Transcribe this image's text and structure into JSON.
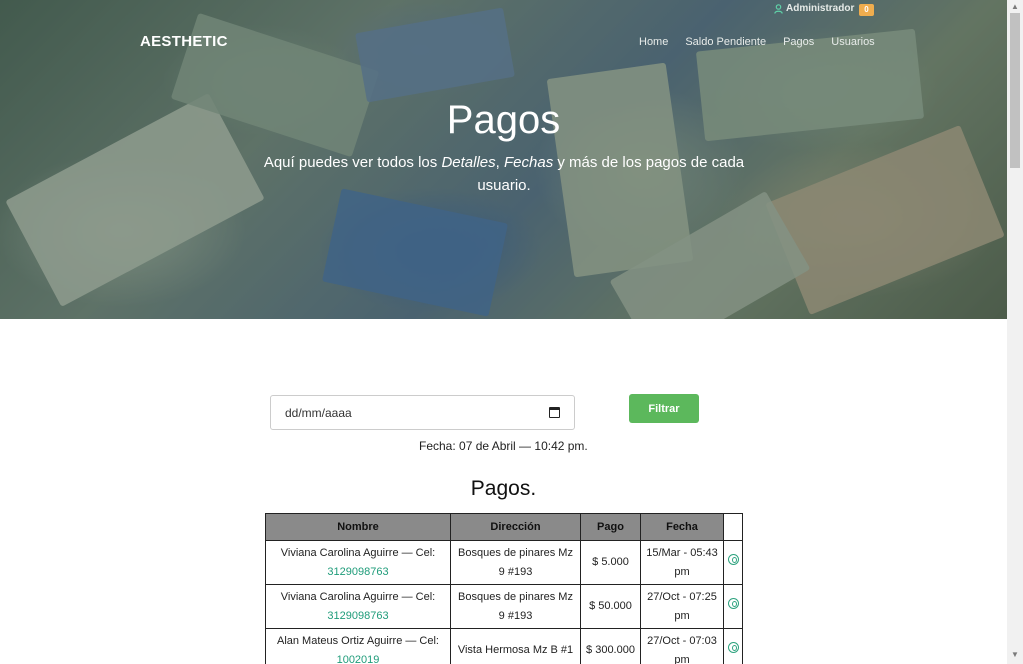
{
  "nav": {
    "brand": "AESTHETIC",
    "items": [
      "Home",
      "Saldo Pendiente",
      "Pagos",
      "Usuarios"
    ],
    "admin_label": "Administrador",
    "notification_count": "0"
  },
  "hero": {
    "title": "Pagos",
    "subtitle_parts": [
      "Aquí puedes ver todos los ",
      "Detalles",
      ", ",
      "Fechas",
      " y más de los pagos de cada usuario."
    ]
  },
  "filter": {
    "date_placeholder": "dd/mm/aaaa",
    "button_label": "Filtrar",
    "fecha_text": "Fecha: 07 de Abril — 10:42 pm."
  },
  "table": {
    "title": "Pagos.",
    "headers": [
      "Nombre",
      "Dirección",
      "Pago",
      "Fecha",
      ""
    ],
    "rows": [
      {
        "nombre": "Viviana Carolina Aguirre — Cel:",
        "cel": "3129098763",
        "direccion": "Bosques de pinares Mz 9 #193",
        "pago": "$ 5.000",
        "fecha": "15/Mar - 05:43 pm"
      },
      {
        "nombre": "Viviana Carolina Aguirre — Cel:",
        "cel": "3129098763",
        "direccion": "Bosques de pinares Mz 9 #193",
        "pago": "$ 50.000",
        "fecha": "27/Oct - 07:25 pm"
      },
      {
        "nombre": "Alan Mateus Ortiz Aguirre — Cel:",
        "cel": "1002019",
        "direccion": "Vista Hermosa Mz B #1",
        "pago": "$ 300.000",
        "fecha": "27/Oct - 07:03 pm"
      }
    ]
  },
  "colors": {
    "accent_green": "#5cb85c",
    "link_teal": "#1f9c7a",
    "badge_orange": "#f0ad4e",
    "header_gray": "#8a8a8a"
  },
  "icons": [
    "user-icon",
    "calendar-icon",
    "payment-icon"
  ]
}
